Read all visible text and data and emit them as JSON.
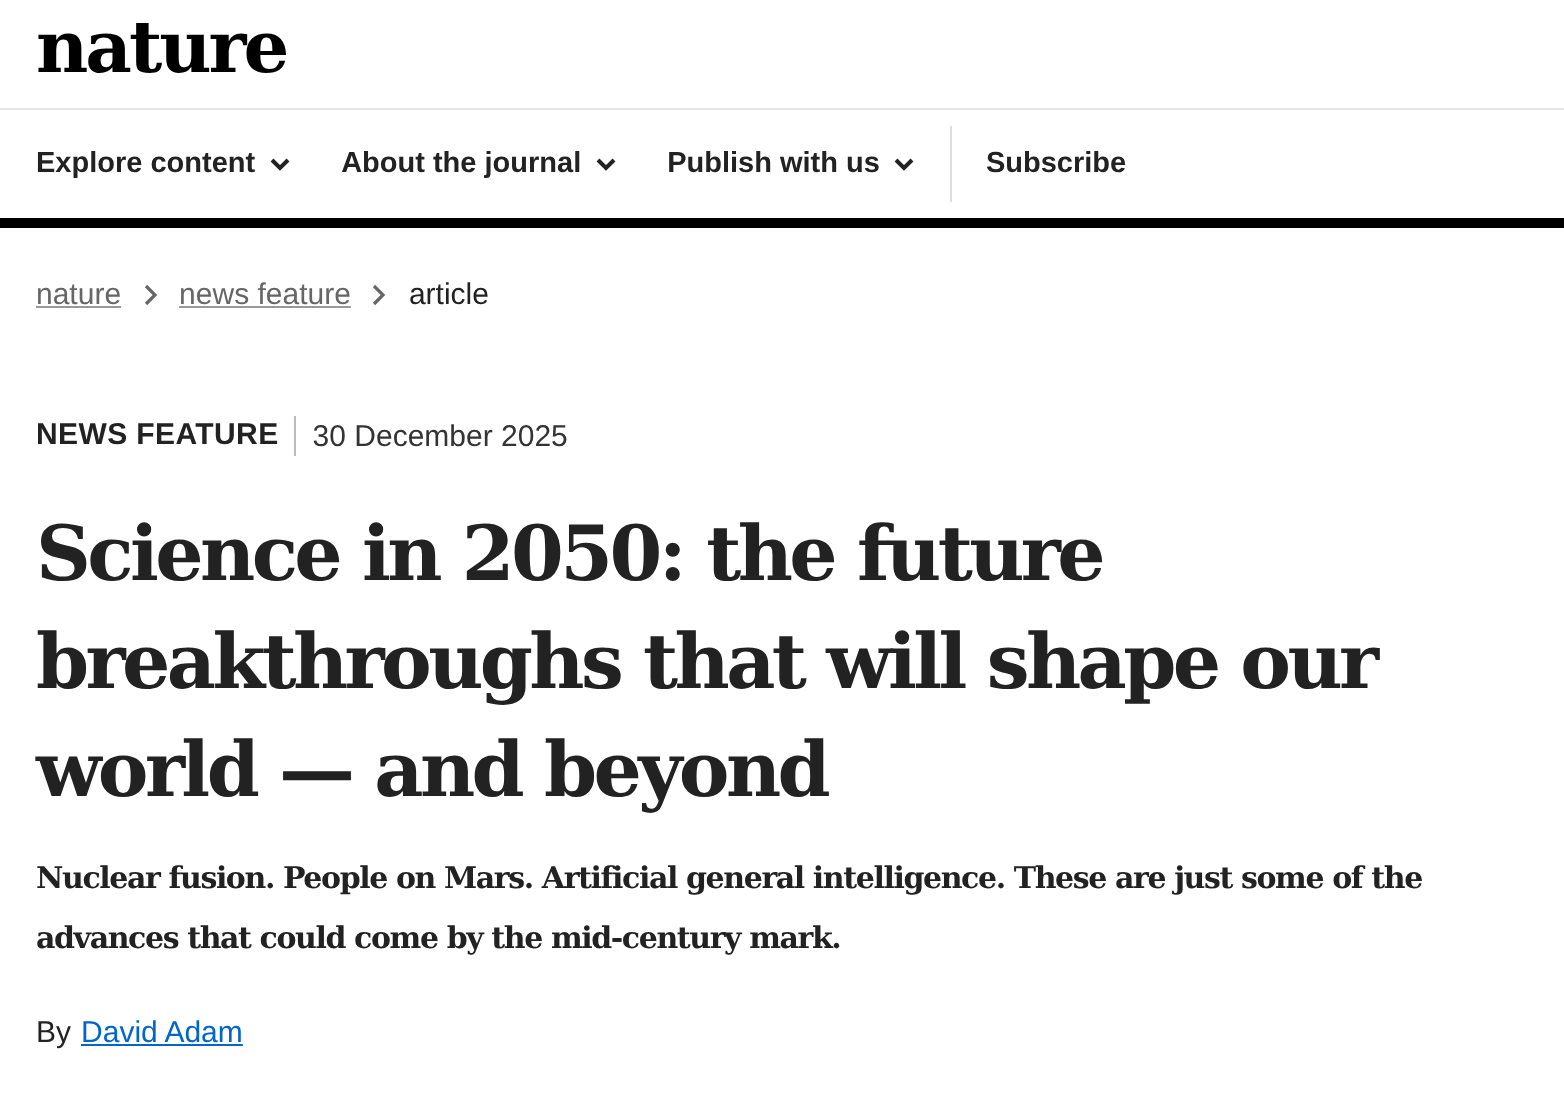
{
  "logo": "nature",
  "nav": [
    {
      "label": "Explore content",
      "has_menu": true
    },
    {
      "label": "About the journal",
      "has_menu": true
    },
    {
      "label": "Publish with us",
      "has_menu": true
    },
    {
      "label": "Subscribe",
      "has_menu": false
    }
  ],
  "breadcrumbs": [
    {
      "label": "nature",
      "link": true
    },
    {
      "label": "news feature",
      "link": true
    },
    {
      "label": "article",
      "link": false
    }
  ],
  "article": {
    "type": "NEWS FEATURE",
    "date": "30 December 2025",
    "title": "Science in 2050: the future breakthroughs that will shape our world — and beyond",
    "standfirst": "Nuclear fusion. People on Mars. Artificial general intelligence. These are just some of the advances that could come by the mid-century mark.",
    "byline_prefix": "By",
    "author": "David Adam"
  }
}
